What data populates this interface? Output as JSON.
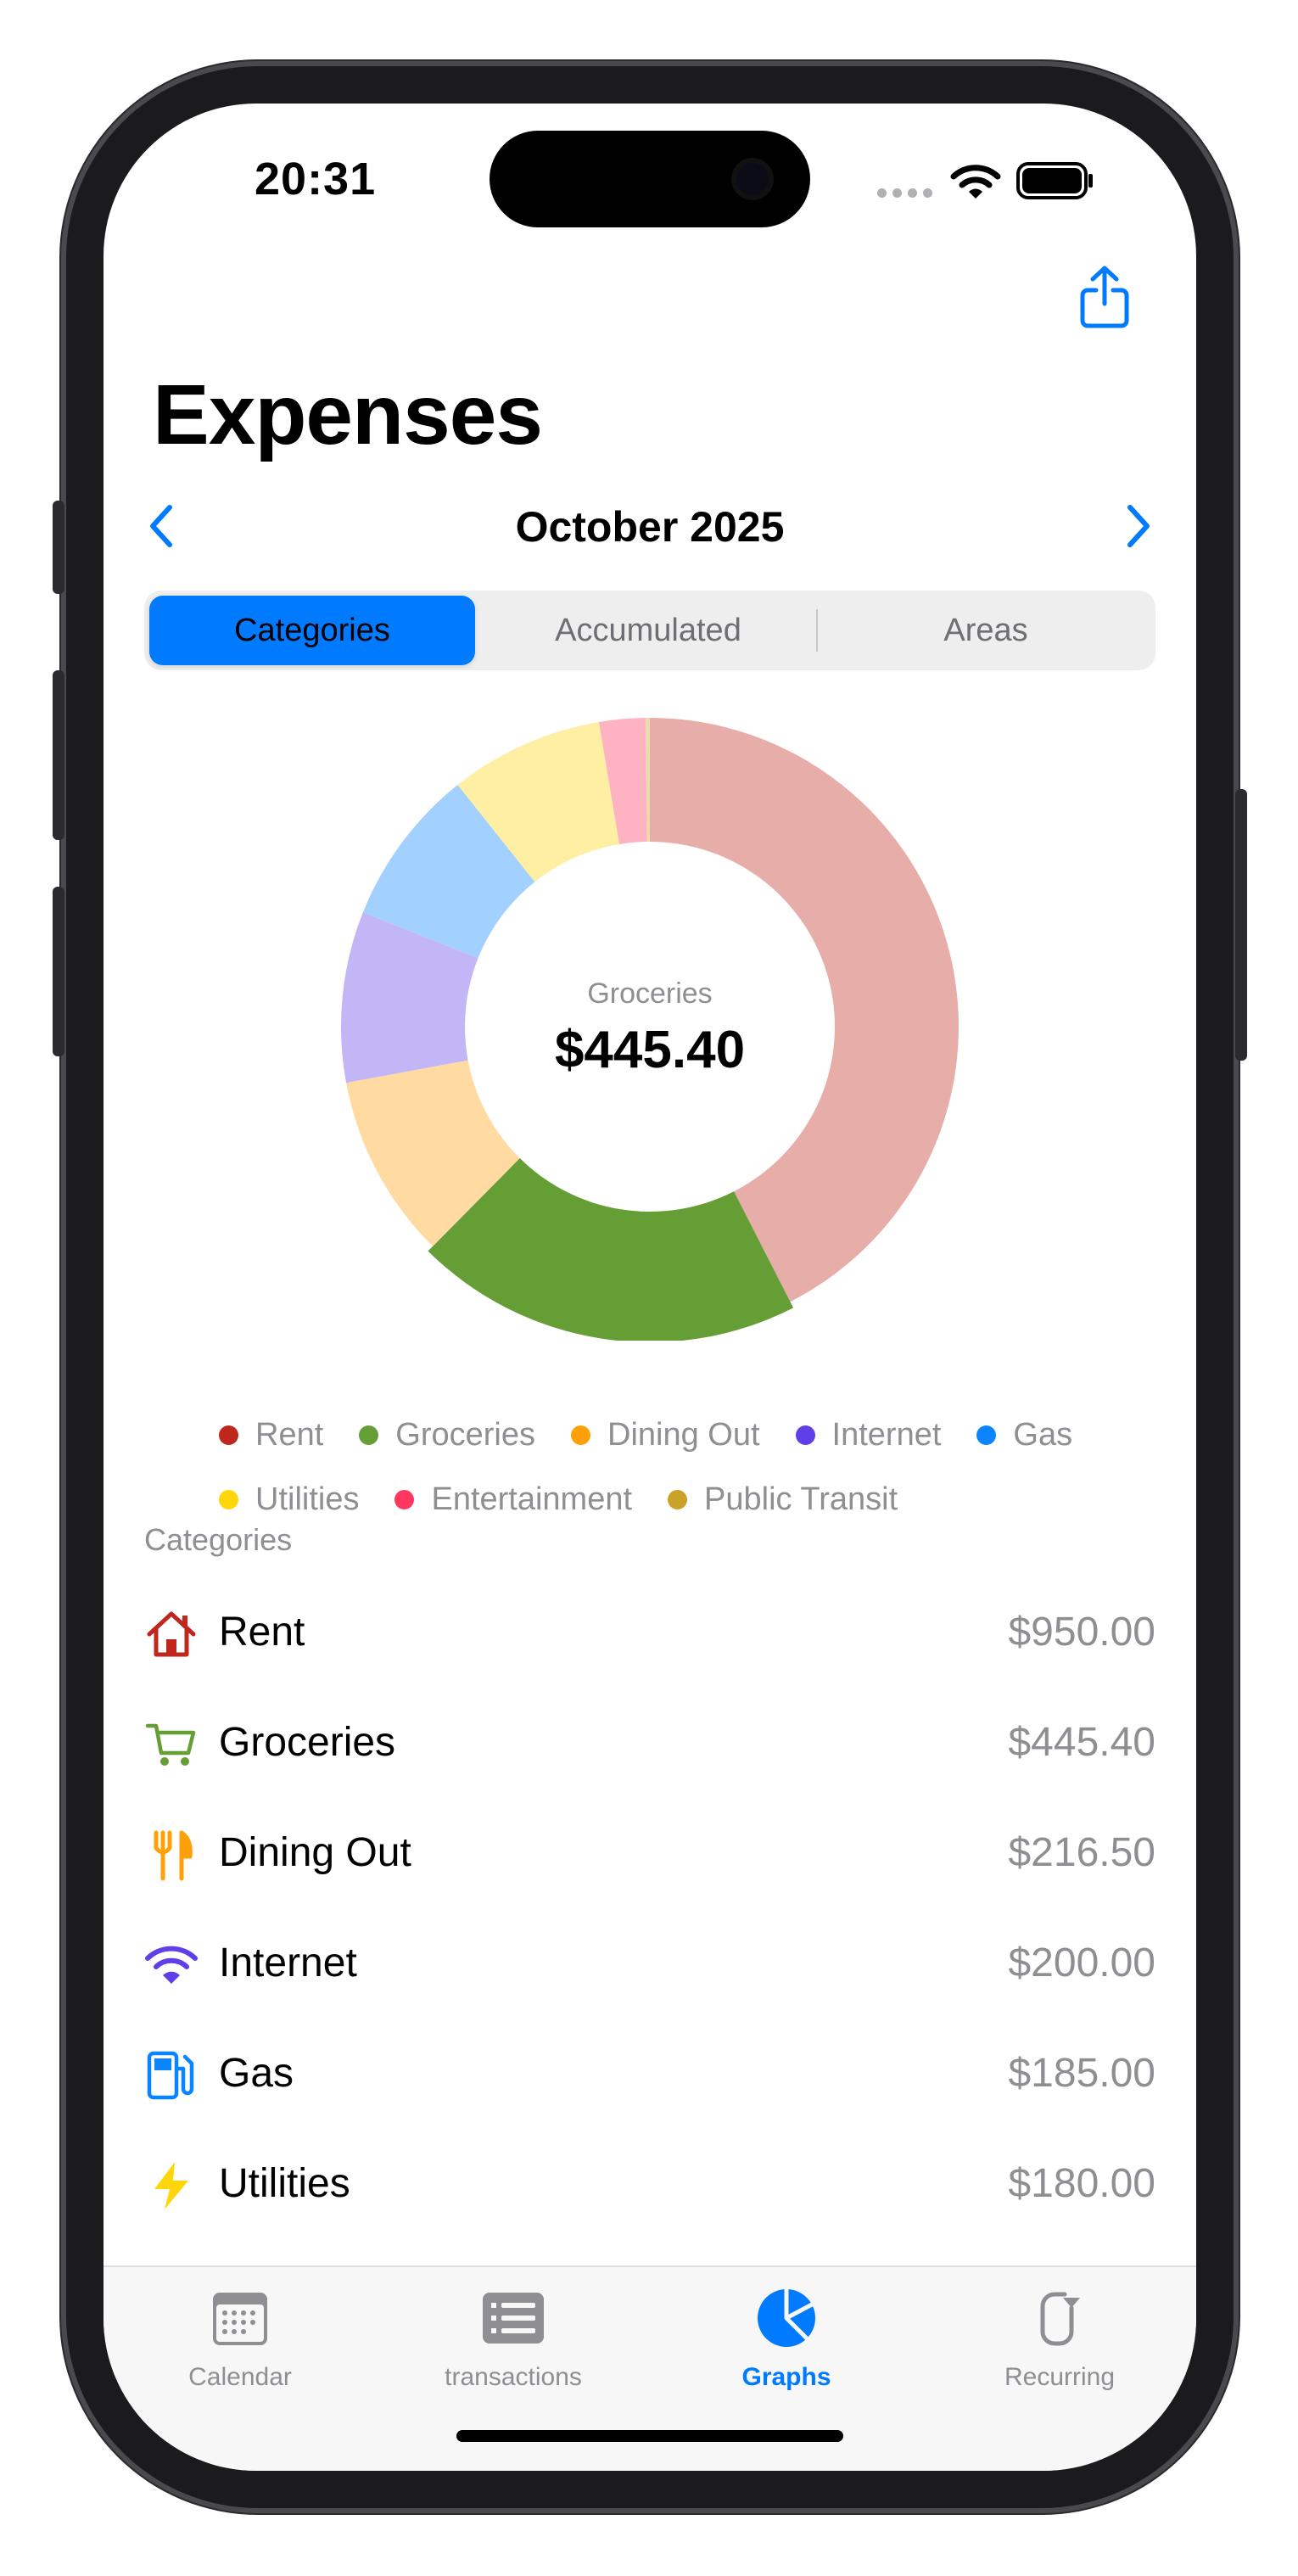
{
  "status": {
    "time": "20:31"
  },
  "header": {
    "title": "Expenses",
    "month": "October 2025"
  },
  "segments": [
    {
      "label": "Categories",
      "active": true
    },
    {
      "label": "Accumulated",
      "active": false
    },
    {
      "label": "Areas",
      "active": false
    }
  ],
  "chart_center": {
    "category": "Groceries",
    "amount": "$445.40"
  },
  "chart_data": {
    "type": "pie",
    "donut": true,
    "selected": "Groceries",
    "categories": [
      "Rent",
      "Groceries",
      "Dining Out",
      "Internet",
      "Gas",
      "Utilities",
      "Entertainment",
      "Public Transit"
    ],
    "values": [
      950.0,
      445.4,
      216.5,
      200.0,
      185.0,
      180.0,
      54.0,
      5.0
    ],
    "colors": [
      "#c0271c",
      "#659e35",
      "#ff9f0a",
      "#5e3fe8",
      "#0a84ff",
      "#ffd60a",
      "#ff375f",
      "#c9a227"
    ],
    "legend": "bottom"
  },
  "legend": [
    {
      "label": "Rent",
      "color": "#c0271c"
    },
    {
      "label": "Groceries",
      "color": "#659e35"
    },
    {
      "label": "Dining Out",
      "color": "#ff9f0a"
    },
    {
      "label": "Internet",
      "color": "#5e3fe8"
    },
    {
      "label": "Gas",
      "color": "#0a84ff"
    },
    {
      "label": "Utilities",
      "color": "#ffd60a"
    },
    {
      "label": "Entertainment",
      "color": "#ff375f"
    },
    {
      "label": "Public Transit",
      "color": "#c9a227"
    }
  ],
  "list": {
    "title": "Categories",
    "rows": [
      {
        "icon": "house-icon",
        "name": "Rent",
        "amount": "$950.00",
        "color": "#c0271c"
      },
      {
        "icon": "cart-icon",
        "name": "Groceries",
        "amount": "$445.40",
        "color": "#659e35"
      },
      {
        "icon": "fork-knife-icon",
        "name": "Dining Out",
        "amount": "$216.50",
        "color": "#ff9f0a"
      },
      {
        "icon": "wifi-icon",
        "name": "Internet",
        "amount": "$200.00",
        "color": "#5e3fe8"
      },
      {
        "icon": "fuel-pump-icon",
        "name": "Gas",
        "amount": "$185.00",
        "color": "#0a84ff"
      },
      {
        "icon": "bolt-icon",
        "name": "Utilities",
        "amount": "$180.00",
        "color": "#ffd60a"
      }
    ]
  },
  "tabs": [
    {
      "label": "Calendar",
      "icon": "calendar-icon",
      "active": false
    },
    {
      "label": "transactions",
      "icon": "list-icon",
      "active": false
    },
    {
      "label": "Graphs",
      "icon": "pie-chart-icon",
      "active": true
    },
    {
      "label": "Recurring",
      "icon": "recurring-icon",
      "active": false
    }
  ],
  "accent": "#007aff"
}
